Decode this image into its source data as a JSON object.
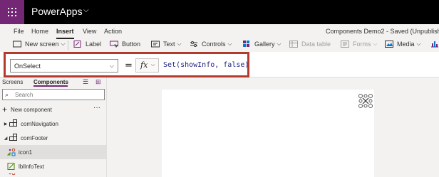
{
  "app": {
    "title": "PowerApps"
  },
  "menu": {
    "items": [
      "File",
      "Home",
      "Insert",
      "View",
      "Action"
    ],
    "active": "Insert",
    "doc_title": "Components Demo2 - Saved (Unpublishe"
  },
  "ribbon": {
    "new_screen": "New screen",
    "label": "Label",
    "button": "Button",
    "text": "Text",
    "controls": "Controls",
    "gallery": "Gallery",
    "data_table": "Data table",
    "forms": "Forms",
    "media": "Media"
  },
  "formula_bar": {
    "property": "OnSelect",
    "equals": "=",
    "fx": "fx",
    "formula": "Set(showInfo, false)"
  },
  "left_pane": {
    "tabs": [
      "Screens",
      "Components"
    ],
    "active_tab": "Components",
    "search_placeholder": "Search",
    "new_component": "New component",
    "more": "···",
    "tree": [
      {
        "label": "comNavigation",
        "icon": "component-icon",
        "expanded": false
      },
      {
        "label": "comFooter",
        "icon": "component-icon",
        "expanded": true
      },
      {
        "label": "icon1",
        "icon": "icon-control-icon",
        "selected": true
      },
      {
        "label": "lblInfoText",
        "icon": "label-icon"
      }
    ]
  },
  "colors": {
    "brand": "#742774",
    "highlight": "#b33b2e"
  }
}
